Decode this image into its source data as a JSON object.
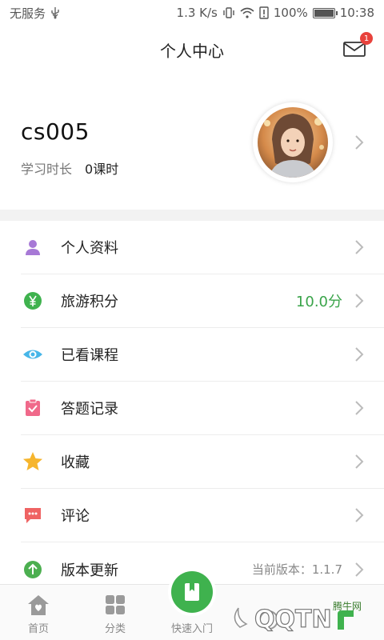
{
  "status_bar": {
    "carrier": "无服务",
    "speed": "1.3 K/s",
    "battery_percent": "100%",
    "time": "10:38",
    "battery_level": 1.0
  },
  "header": {
    "title": "个人中心",
    "mail_badge": "1"
  },
  "profile": {
    "username": "cs005",
    "study_label": "学习时长",
    "study_value": "0课时"
  },
  "menu": [
    {
      "label": "个人资料",
      "value": "",
      "icon": "person-icon",
      "color": "#a779d6"
    },
    {
      "label": "旅游积分",
      "value": "10.0分",
      "icon": "yen-coin-icon",
      "color": "#3fb24e"
    },
    {
      "label": "已看课程",
      "value": "",
      "icon": "eye-icon",
      "color": "#47b6e8"
    },
    {
      "label": "答题记录",
      "value": "",
      "icon": "clipboard-check-icon",
      "color": "#f0698a"
    },
    {
      "label": "收藏",
      "value": "",
      "icon": "star-icon",
      "color": "#f6b52d"
    },
    {
      "label": "评论",
      "value": "",
      "icon": "comment-icon",
      "color": "#ef6363"
    },
    {
      "label": "版本更新",
      "value": "当前版本：1.1.7",
      "icon": "upload-arrow-icon",
      "color": "#4caf50"
    }
  ],
  "tabs": [
    {
      "label": "首页",
      "icon": "home-icon"
    },
    {
      "label": "分类",
      "icon": "grid-icon"
    },
    {
      "label": "快速入门",
      "icon": "book-icon"
    },
    {
      "label": "",
      "icon": "circle-icon"
    },
    {
      "label": "",
      "icon": "profile-icon"
    }
  ],
  "watermark": {
    "text": "腾牛网",
    "brand": "QQTN"
  },
  "colors": {
    "accent_green": "#3fb24e",
    "badge_red": "#e8423c"
  }
}
